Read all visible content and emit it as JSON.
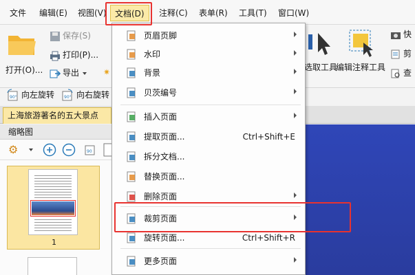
{
  "menubar": {
    "items": [
      "文件",
      "编辑(E)",
      "视图(V)",
      "文档(D)",
      "注释(C)",
      "表单(R)",
      "工具(T)",
      "窗口(W)"
    ],
    "active_index": 3
  },
  "ribbon": {
    "open_label": "打开(O)...",
    "save_label": "保存(S)",
    "print_label": "打印(P)...",
    "export_label": "导出",
    "rotate_left_label": "向左旋转",
    "rotate_right_label": "向右旋转",
    "select_tool_label": "选取工具",
    "edit_annot_label": "编辑注释工具",
    "right_cut_1": "快",
    "right_cut_2": "剪",
    "right_cut_3": "查"
  },
  "tab": {
    "title": "上海旅游著名的五大景点"
  },
  "panel": {
    "title": "缩略图",
    "page_number": "1"
  },
  "dropdown": {
    "items": [
      {
        "label": "页眉页脚",
        "shortcut": "",
        "submenu": true,
        "icon": "header-footer-icon"
      },
      {
        "label": "水印",
        "shortcut": "",
        "submenu": true,
        "icon": "watermark-icon"
      },
      {
        "label": "背景",
        "shortcut": "",
        "submenu": true,
        "icon": "background-icon"
      },
      {
        "label": "贝茨编号",
        "shortcut": "",
        "submenu": true,
        "icon": "bates-number-icon"
      },
      {
        "label": "插入页面",
        "shortcut": "",
        "submenu": true,
        "icon": "insert-page-icon"
      },
      {
        "label": "提取页面...",
        "shortcut": "Ctrl+Shift+E",
        "submenu": false,
        "icon": "extract-page-icon"
      },
      {
        "label": "拆分文档...",
        "shortcut": "",
        "submenu": false,
        "icon": "split-document-icon"
      },
      {
        "label": "替换页面...",
        "shortcut": "",
        "submenu": false,
        "icon": "replace-page-icon"
      },
      {
        "label": "删除页面",
        "shortcut": "",
        "submenu": true,
        "icon": "delete-page-icon"
      },
      {
        "label": "裁剪页面",
        "shortcut": "",
        "submenu": true,
        "icon": "crop-page-icon"
      },
      {
        "label": "旋转页面...",
        "shortcut": "Ctrl+Shift+R",
        "submenu": false,
        "icon": "rotate-page-icon"
      },
      {
        "label": "更多页面",
        "shortcut": "",
        "submenu": true,
        "icon": "more-pages-icon"
      }
    ]
  },
  "colors": {
    "highlight_red": "#e8322f",
    "menu_active_bg": "#fbeaa8",
    "tab_bg": "#fbe8a6",
    "viewer_bg": "#2f46b8"
  }
}
